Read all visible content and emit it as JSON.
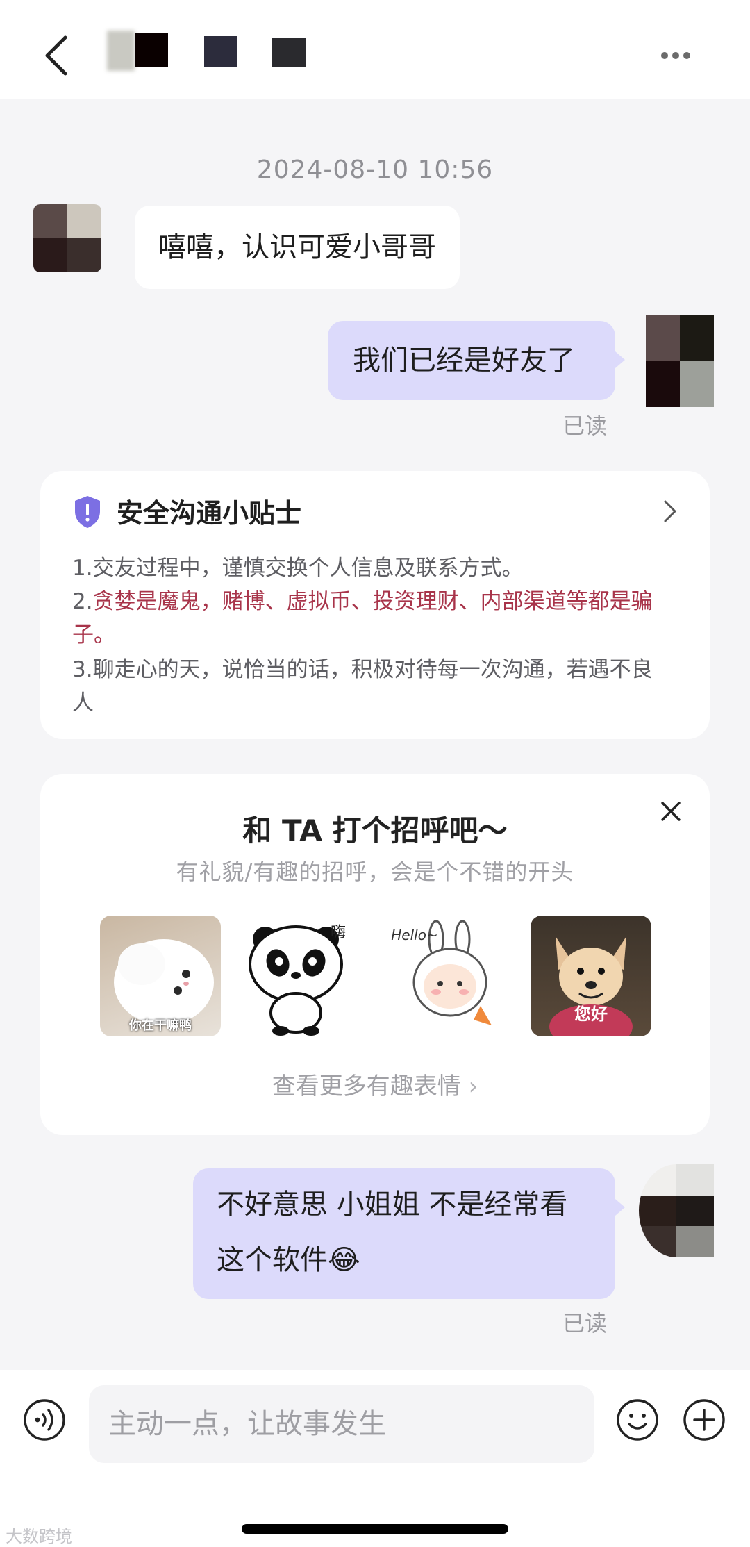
{
  "header": {},
  "chat": {
    "timestamp": "2024-08-10 10:56",
    "messages": [
      {
        "direction": "in",
        "text": "嘻嘻，认识可爱小哥哥"
      },
      {
        "direction": "out",
        "text": "我们已经是好友了",
        "status": "已读"
      },
      {
        "direction": "out",
        "text_line1": "不好意思 小姐姐 不是经常看",
        "text_line2": "这个软件😂",
        "status": "已读"
      }
    ]
  },
  "safety_tips": {
    "title": "安全沟通小贴士",
    "line1": "1.交友过程中，谨慎交换个人信息及联系方式。",
    "line2a": "2.",
    "line2b": "贪婪是魔鬼，赌博、虚拟币、投资理财、内部渠道等都是骗",
    "line2c": "子。",
    "line3a": "3.聊走心的天，说恰当的话，积极对待每一次沟通，若遇不良",
    "line3b": "人",
    "icon": "shield-alert-icon",
    "accent": "#7c6fe3"
  },
  "greeting_card": {
    "title": "和 TA 打个招呼吧～",
    "subtitle": "有礼貌/有趣的招呼，会是个不错的开头",
    "stickers": [
      {
        "name": "white-cat-sticker",
        "caption": "你在干嘛鸭"
      },
      {
        "name": "panda-sticker",
        "caption": "嗨"
      },
      {
        "name": "bunny-sticker",
        "caption": "Hello~"
      },
      {
        "name": "dog-sticker",
        "caption": "您好"
      }
    ],
    "more_link": "查看更多有趣表情"
  },
  "input_bar": {
    "placeholder": "主动一点，让故事发生"
  },
  "watermark": "大数跨境",
  "colors": {
    "outgoing_bubble": "#dcdafb",
    "incoming_bubble": "#ffffff",
    "background": "#f5f5f7",
    "warning_text": "#a8344a"
  }
}
